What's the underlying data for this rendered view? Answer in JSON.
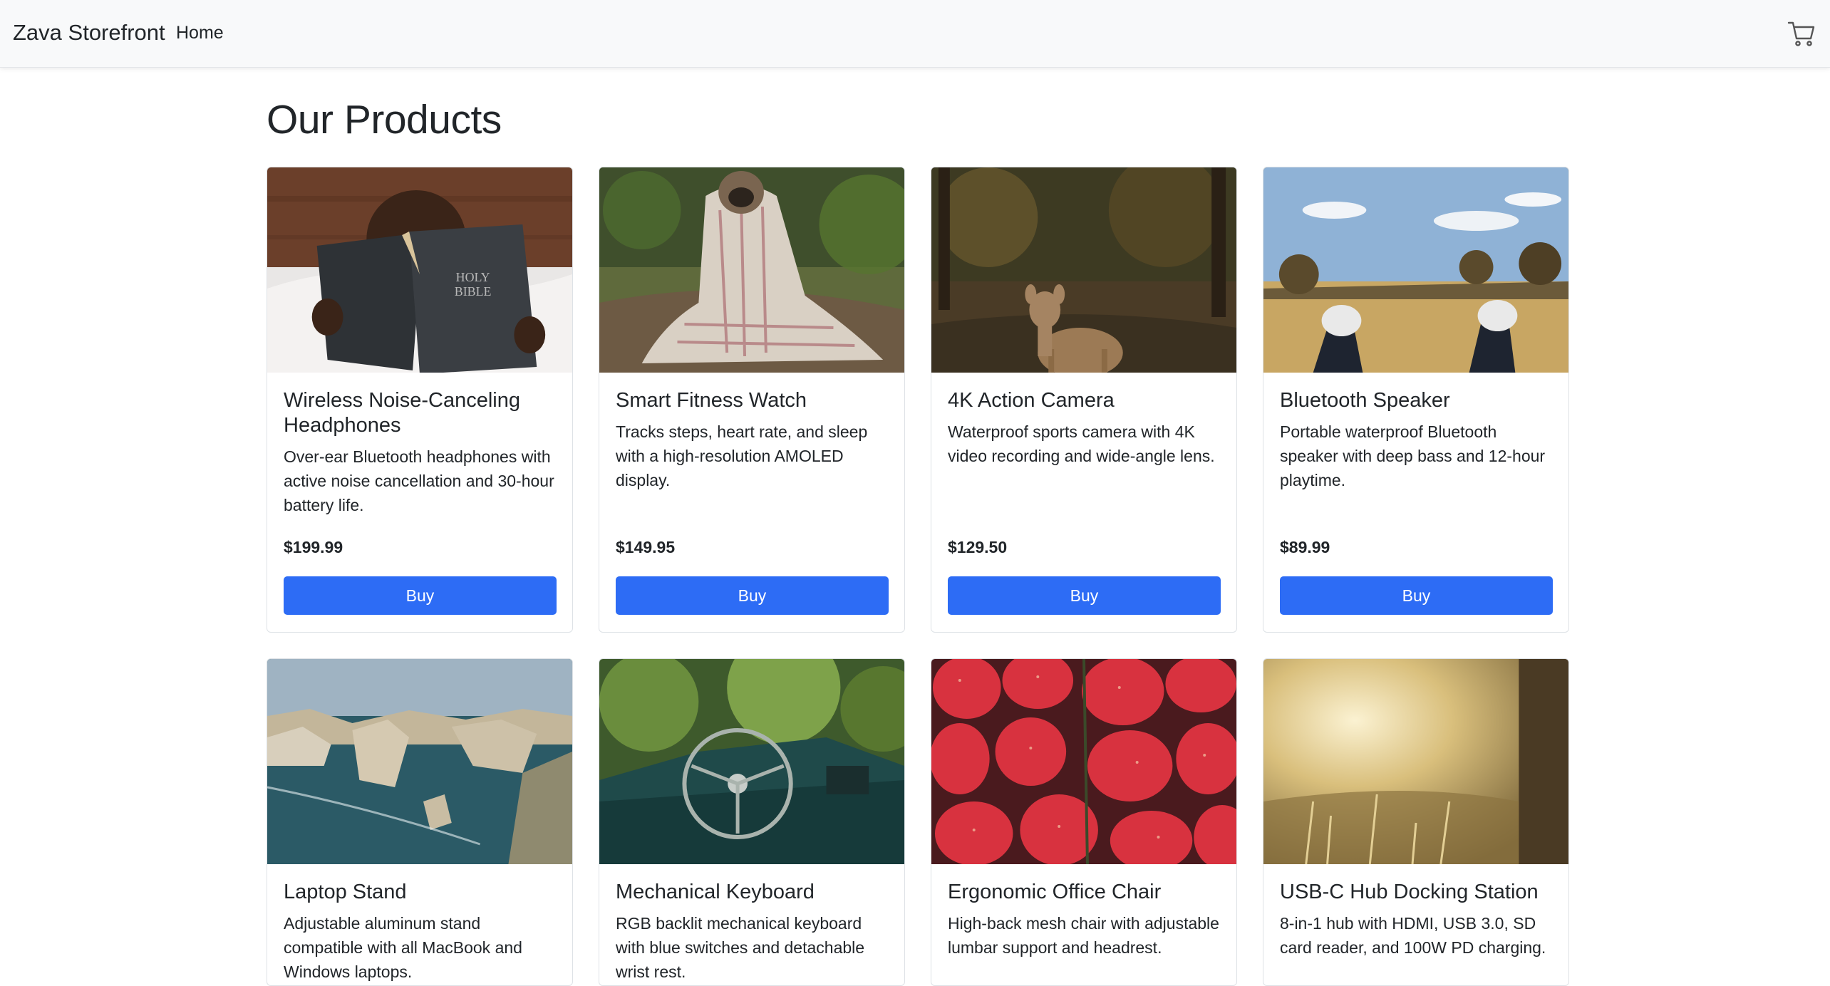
{
  "navbar": {
    "brand": "Zava Storefront",
    "home_label": "Home",
    "cart_icon": "cart-icon"
  },
  "page": {
    "title": "Our Products"
  },
  "colors": {
    "accent": "#2d6cf5",
    "navbar_bg": "#f8f9fa"
  },
  "products": [
    {
      "name": "Wireless Noise-Canceling Headphones",
      "description": "Over-ear Bluetooth headphones with active noise cancellation and 30-hour battery life.",
      "price": "$199.99",
      "buy_label": "Buy",
      "image": "child-reading-book"
    },
    {
      "name": "Smart Fitness Watch",
      "description": "Tracks steps, heart rate, and sleep with a high-resolution AMOLED display.",
      "price": "$149.95",
      "buy_label": "Buy",
      "image": "pug-in-blanket"
    },
    {
      "name": "4K Action Camera",
      "description": "Waterproof sports camera with 4K video recording and wide-angle lens.",
      "price": "$129.50",
      "buy_label": "Buy",
      "image": "fawn-in-forest"
    },
    {
      "name": "Bluetooth Speaker",
      "description": "Portable waterproof Bluetooth speaker with deep bass and 12-hour playtime.",
      "price": "$89.99",
      "buy_label": "Buy",
      "image": "sneakers-in-field"
    },
    {
      "name": "Laptop Stand",
      "description": "Adjustable aluminum stand compatible with all MacBook and Windows laptops.",
      "image": "coastal-cliffs"
    },
    {
      "name": "Mechanical Keyboard",
      "description": "RGB backlit mechanical keyboard with blue switches and detachable wrist rest.",
      "image": "old-car-dashboard"
    },
    {
      "name": "Ergonomic Office Chair",
      "description": "High-back mesh chair with adjustable lumbar support and headrest.",
      "image": "strawberries"
    },
    {
      "name": "USB-C Hub Docking Station",
      "description": "8-in-1 hub with HDMI, USB 3.0, SD card reader, and 100W PD charging.",
      "image": "sunlit-meadow"
    }
  ]
}
